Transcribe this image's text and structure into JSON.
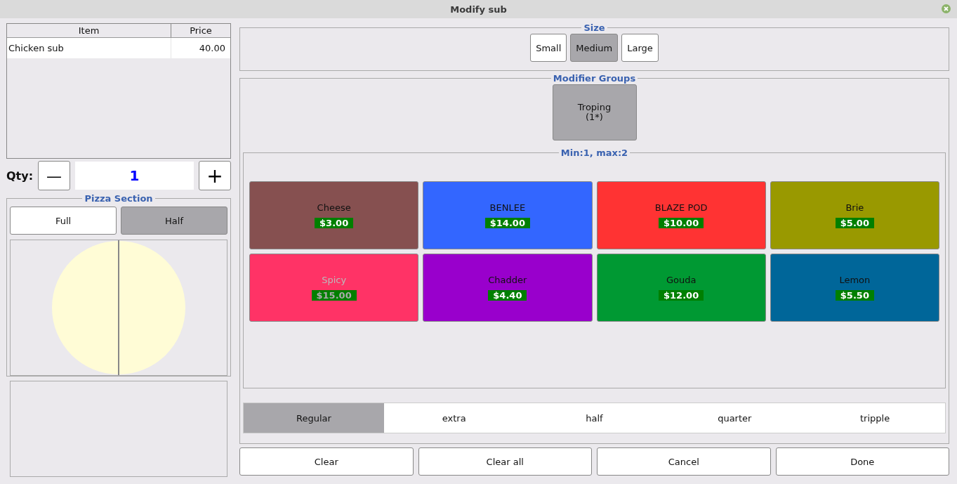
{
  "window": {
    "title": "Modify sub"
  },
  "table": {
    "columns": [
      "Item",
      "Price"
    ],
    "rows": [
      {
        "cells": [
          "Chicken sub",
          "40.00"
        ],
        "selected": false
      }
    ]
  },
  "qty": {
    "label": "Qty:",
    "minus": "—",
    "value": "1",
    "plus": "+"
  },
  "pizza_section": {
    "title": "Pizza Section",
    "options": [
      {
        "label": "Full",
        "selected": false
      },
      {
        "label": "Half",
        "selected": true
      }
    ]
  },
  "size": {
    "title": "Size",
    "options": [
      {
        "label": "Small",
        "selected": false
      },
      {
        "label": "Medium",
        "selected": true
      },
      {
        "label": "Large",
        "selected": false
      }
    ]
  },
  "modifier_groups": {
    "title": "Modifier Groups",
    "groups": [
      {
        "label": "Troping",
        "count": "(1*)",
        "selected": true
      }
    ]
  },
  "modifiers": {
    "title": "Min:1, max:2",
    "items": [
      {
        "name": "Cheese",
        "price": "$3.00",
        "color": "#865050",
        "disabled": false
      },
      {
        "name": "BENLEE",
        "price": "$14.00",
        "color": "#3366ff",
        "disabled": false
      },
      {
        "name": "BLAZE POD",
        "price": "$10.00",
        "color": "#ff3333",
        "disabled": false
      },
      {
        "name": "Brie",
        "price": "$5.00",
        "color": "#999900",
        "disabled": false
      },
      {
        "name": "Spicy",
        "price": "$15.00",
        "color": "#ff3366",
        "disabled": true
      },
      {
        "name": "Chadder",
        "price": "$4.40",
        "color": "#9900cc",
        "disabled": false
      },
      {
        "name": "Gouda",
        "price": "$12.00",
        "color": "#009933",
        "disabled": false
      },
      {
        "name": "Lemon",
        "price": "$5.50",
        "color": "#006699",
        "disabled": false
      }
    ]
  },
  "portions": [
    {
      "label": "Regular",
      "selected": true
    },
    {
      "label": "extra",
      "selected": false
    },
    {
      "label": "half",
      "selected": false
    },
    {
      "label": "quarter",
      "selected": false
    },
    {
      "label": "tripple",
      "selected": false
    }
  ],
  "buttons": [
    "Clear",
    "Clear all",
    "Cancel",
    "Done"
  ]
}
